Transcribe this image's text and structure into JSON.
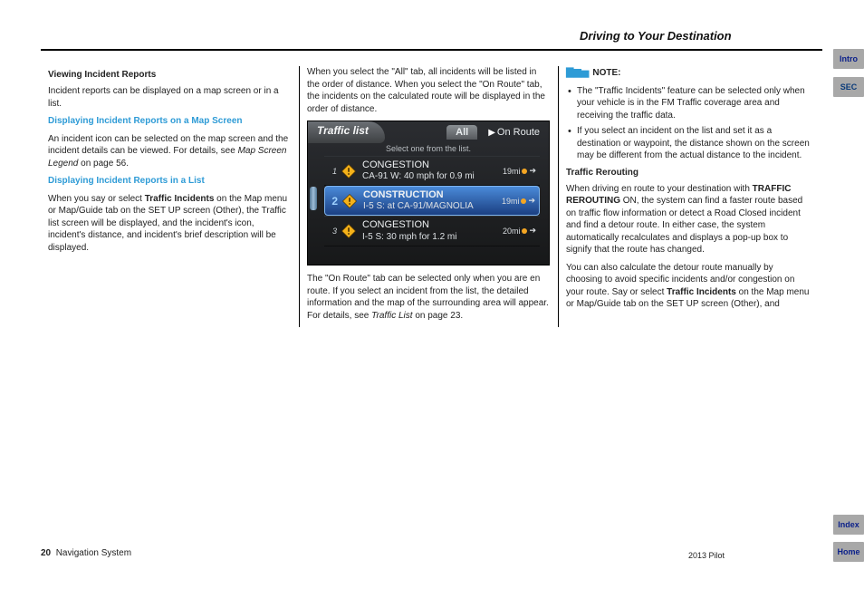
{
  "header": {
    "title": "Driving to Your Destination"
  },
  "sideNav": {
    "intro": "Intro",
    "sec": "SEC",
    "index": "Index",
    "home": "Home"
  },
  "footer": {
    "page": "20",
    "leftText": "Navigation System",
    "rightText": "2013 Pilot"
  },
  "col1": {
    "title": "Viewing Incident Reports",
    "p1": "Incident reports can be displayed on a map screen or in a list.",
    "sub1": "Displaying Incident Reports on a Map Screen",
    "p2_part1": "An incident icon can be selected on the map screen and the incident details can be viewed. For details, see ",
    "p2_link": "Map Screen Legend",
    "p2_part2": " on page 56.",
    "sub2": "Displaying Incident Reports in a List",
    "p3_a": "When you say or select ",
    "p3_b": "Traffic Incidents",
    "p3_c": " on the Map menu or Map/Guide tab on the SET UP screen (Other), the Traffic list screen will be displayed, and the incident's icon, incident's distance, and incident's brief description will be displayed."
  },
  "col2": {
    "p1": "When you select the \"All\" tab, all incidents will be listed in the order of distance. When you select the \"On Route\" tab, the incidents on the calculated route will be displayed in the order of distance.",
    "p2_a": "The \"On Route\" tab can be selected only when you are en route. If you select an incident from the list, the detailed information and the map of the surrounding area will appear. For details, see ",
    "p2_link": "Traffic List",
    "p2_b": " on page 23.",
    "screenshot": {
      "title": "Traffic list",
      "tabAll": "All",
      "tabOnRoute": "On Route",
      "subtext": "Select one from the list.",
      "items": [
        {
          "idx": "1",
          "type": "CONGESTION",
          "desc": "CA-91 W: 40 mph for 0.9 mi",
          "dist": "19mi",
          "selected": false
        },
        {
          "idx": "2",
          "type": "CONSTRUCTION",
          "desc": "I-5 S: at CA-91/MAGNOLIA",
          "dist": "19mi",
          "selected": true
        },
        {
          "idx": "3",
          "type": "CONGESTION",
          "desc": "I-5 S: 30 mph for 1.2 mi",
          "dist": "20mi",
          "selected": false
        }
      ]
    }
  },
  "col3": {
    "note_label": "NOTE:",
    "b1": "The \"Traffic Incidents\" feature can be selected only when your vehicle is in the FM Traffic coverage area and receiving the traffic data.",
    "b2": "If you select an incident on the list and set it as a destination or waypoint, the distance shown on the screen may be different from the actual distance to the incident.",
    "title2": "Traffic Rerouting",
    "p1_a": "When driving en route to your destination with ",
    "p1_b": "TRAFFIC REROUTING ",
    "p1_c": "ON",
    "p1_d": ", the system can find a faster route based on traffic flow information or detect a Road Closed incident and find a detour route. In either case, the system automatically recalculates and displays a pop-up box to signify that the route has changed.",
    "p2_a": "You can also calculate the detour route manually by choosing to avoid specific incidents and/or congestion on your route. Say or select ",
    "p2_b": "Traffic Incidents",
    "p2_c": " on the Map menu or Map/Guide tab on the SET UP screen (Other), and"
  }
}
